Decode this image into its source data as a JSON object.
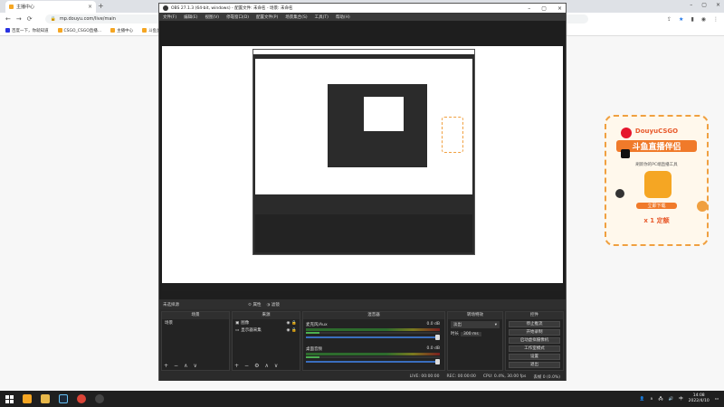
{
  "browser": {
    "tab_title": "主播中心",
    "url": "mp.douyu.com/live/main",
    "bookmarks": [
      "百度一下，你就知道",
      "CSGO_CSGO直播...",
      "主播中心",
      "斗鱼直播 - 每个..."
    ]
  },
  "obs": {
    "title": "OBS 27.1.3 (64-bit, windows) - 配置文件: 未命名 - 场景: 未命名",
    "menu": [
      "文件(F)",
      "编辑(E)",
      "视图(V)",
      "停靠窗口(D)",
      "配置文件(P)",
      "场景集合(S)",
      "工具(T)",
      "帮助(H)"
    ],
    "scene_status": "未选择源",
    "properties_label": "属性",
    "filters_label": "滤镜",
    "docks": {
      "scenes": {
        "header": "场景",
        "items": [
          "场景"
        ]
      },
      "sources": {
        "header": "来源",
        "items": [
          "图像",
          "显示器采集"
        ]
      },
      "mixer": {
        "header": "混音器",
        "tracks": [
          {
            "name": "麦克风/Aux",
            "db": "0.0 dB"
          },
          {
            "name": "桌面音频",
            "db": "0.0 dB"
          }
        ]
      },
      "transitions": {
        "header": "转场特效",
        "type": "淡出",
        "duration_label": "时长",
        "duration_value": "300 ms"
      },
      "controls": {
        "header": "控件",
        "buttons": [
          "停止推流",
          "开始录制",
          "启动虚拟摄像机",
          "工作室模式",
          "设置",
          "退出"
        ]
      }
    },
    "statusbar": {
      "live": "LIVE: 00:00:00",
      "rec": "REC: 00:00:00",
      "cpu": "CPU: 0.4%, 30.00 fps",
      "dropped": "丢帧 0 (0.0%)"
    }
  },
  "promo": {
    "brand": "DouyuCSGO",
    "title": "斗鱼直播伴侣",
    "subtitle": "刷新你的PC端直播工具",
    "cta": "立即下载",
    "x_label": "x 1 定额"
  },
  "taskbar": {
    "time": "14:08",
    "date": "2022/4/10"
  },
  "colors": {
    "obs_bg": "#2b2b2b",
    "accent": "#3a6ebd",
    "promo_border": "#f0a040",
    "douyu_orange": "#f5a623"
  }
}
